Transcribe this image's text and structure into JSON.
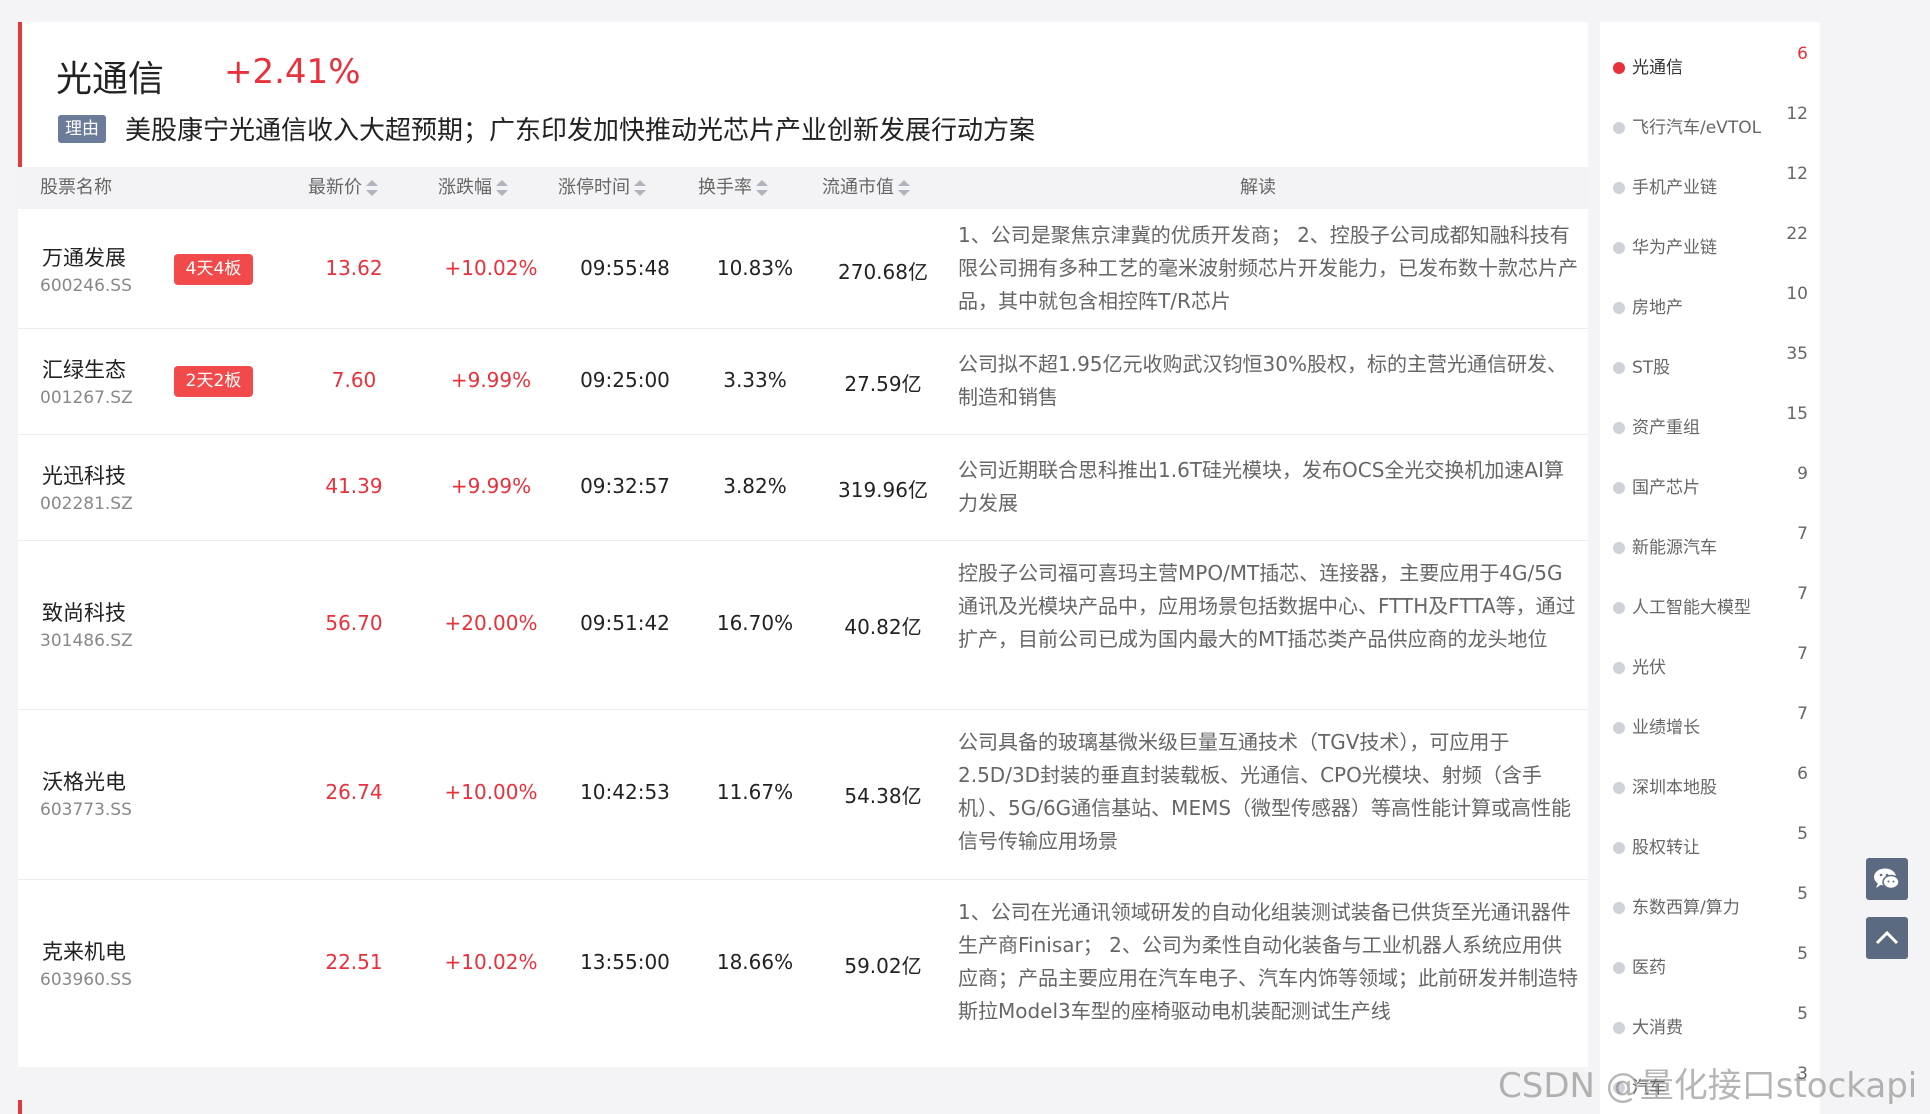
{
  "sector": {
    "name": "光通信",
    "change": "+2.41%",
    "reason_tag": "理由",
    "reason": "美股康宁光通信收入大超预期；广东印发加快推动光芯片产业创新发展行动方案"
  },
  "table": {
    "headers": {
      "name": "股票名称",
      "price": "最新价",
      "pct": "涨跌幅",
      "time": "涨停时间",
      "turnover": "换手率",
      "mcap": "流通市值",
      "desc": "解读"
    },
    "rows": [
      {
        "name": "万通发展",
        "code": "600246.SS",
        "badge": "4天4板",
        "price": "13.62",
        "pct": "+10.02%",
        "time": "09:55:48",
        "turnover": "10.83%",
        "mcap": "270.68亿",
        "desc": "1、公司是聚焦京津冀的优质开发商； 2、控股子公司成都知融科技有限公司拥有多种工艺的毫米波射频芯片开发能力，已发布数十款芯片产品，其中就包含相控阵T/R芯片"
      },
      {
        "name": "汇绿生态",
        "code": "001267.SZ",
        "badge": "2天2板",
        "price": "7.60",
        "pct": "+9.99%",
        "time": "09:25:00",
        "turnover": "3.33%",
        "mcap": "27.59亿",
        "desc": "公司拟不超1.95亿元收购武汉钧恒30%股权，标的主营光通信研发、制造和销售"
      },
      {
        "name": "光迅科技",
        "code": "002281.SZ",
        "badge": "",
        "price": "41.39",
        "pct": "+9.99%",
        "time": "09:32:57",
        "turnover": "3.82%",
        "mcap": "319.96亿",
        "desc": "公司近期联合思科推出1.6T硅光模块，发布OCS全光交换机加速AI算力发展"
      },
      {
        "name": "致尚科技",
        "code": "301486.SZ",
        "badge": "",
        "price": "56.70",
        "pct": "+20.00%",
        "time": "09:51:42",
        "turnover": "16.70%",
        "mcap": "40.82亿",
        "desc": "控股子公司福可喜玛主营MPO/MT插芯、连接器，主要应用于4G/5G通讯及光模块产品中，应用场景包括数据中心、FTTH及FTTA等，通过扩产，目前公司已成为国内最大的MT插芯类产品供应商的龙头地位"
      },
      {
        "name": "沃格光电",
        "code": "603773.SS",
        "badge": "",
        "price": "26.74",
        "pct": "+10.00%",
        "time": "10:42:53",
        "turnover": "11.67%",
        "mcap": "54.38亿",
        "desc": "公司具备的玻璃基微米级巨量互通技术（TGV技术），可应用于2.5D/3D封装的垂直封装载板、光通信、CPO光模块、射频（含手机）、5G/6G通信基站、MEMS（微型传感器）等高性能计算或高性能信号传输应用场景"
      },
      {
        "name": "克来机电",
        "code": "603960.SS",
        "badge": "",
        "price": "22.51",
        "pct": "+10.02%",
        "time": "13:55:00",
        "turnover": "18.66%",
        "mcap": "59.02亿",
        "desc": "1、公司在光通讯领域研发的自动化组装测试装备已供货至光通讯器件生产商Finisar； 2、公司为柔性自动化装备与工业机器人系统应用供应商；产品主要应用在汽车电子、汽车内饰等领域；此前研发并制造特斯拉Model3车型的座椅驱动电机装配测试生产线"
      }
    ]
  },
  "sidebar": {
    "items": [
      {
        "label": "光通信",
        "count": "6"
      },
      {
        "label": "飞行汽车/eVTOL",
        "count": "12"
      },
      {
        "label": "手机产业链",
        "count": "12"
      },
      {
        "label": "华为产业链",
        "count": "22"
      },
      {
        "label": "房地产",
        "count": "10"
      },
      {
        "label": "ST股",
        "count": "35"
      },
      {
        "label": "资产重组",
        "count": "15"
      },
      {
        "label": "国产芯片",
        "count": "9"
      },
      {
        "label": "新能源汽车",
        "count": "7"
      },
      {
        "label": "人工智能大模型",
        "count": "7"
      },
      {
        "label": "光伏",
        "count": "7"
      },
      {
        "label": "业绩增长",
        "count": "7"
      },
      {
        "label": "深圳本地股",
        "count": "6"
      },
      {
        "label": "股权转让",
        "count": "5"
      },
      {
        "label": "东数西算/算力",
        "count": "5"
      },
      {
        "label": "医药",
        "count": "5"
      },
      {
        "label": "大消费",
        "count": "5"
      },
      {
        "label": "汽车",
        "count": "3"
      }
    ]
  },
  "watermark": "CSDN @量化接口stockapi",
  "icons": {
    "chat": "wechat-icon",
    "top": "chevron-up-icon"
  },
  "colors": {
    "up": "#e8313a",
    "badge": "#f24a4a",
    "accent_bar": "#e23a3a",
    "tag": "#6b7b9a"
  }
}
